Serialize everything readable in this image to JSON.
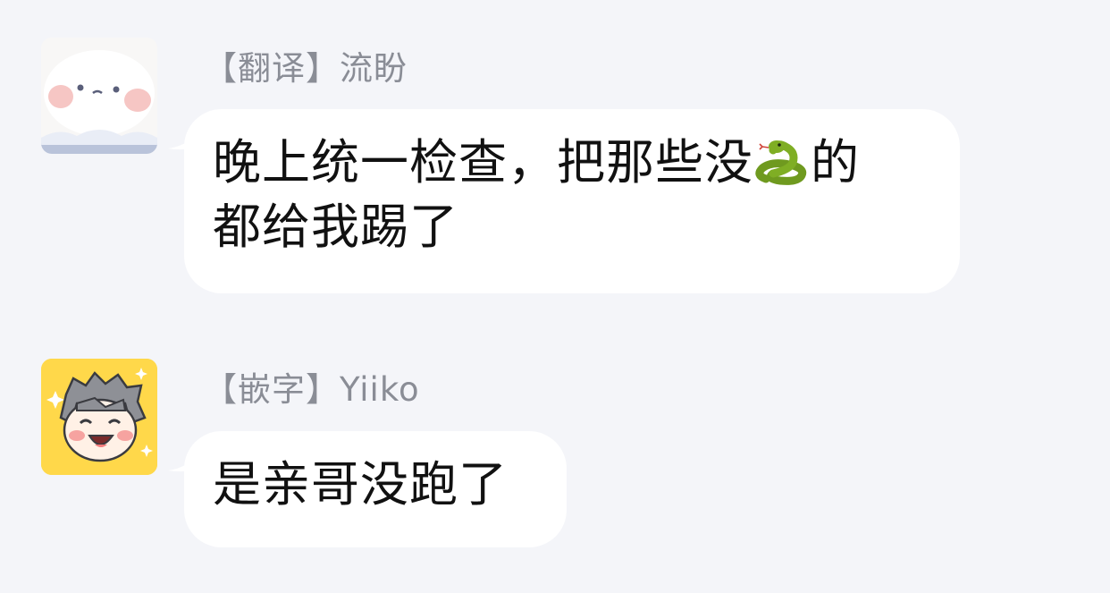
{
  "messages": [
    {
      "sender": "【翻译】流盼",
      "avatar_icon": "white-fluffy-cat-avatar",
      "text_line1": "晚上统一检查，把那些没",
      "emoji_icon": "snake-emoji",
      "text_line1_end": "的",
      "text_line2": "都给我踢了"
    },
    {
      "sender": "【嵌字】Yiiko",
      "avatar_icon": "cartoon-boy-avatar",
      "text": "是亲哥没跑了"
    }
  ],
  "colors": {
    "background": "#f4f5f9",
    "bubble": "#ffffff",
    "sender_text": "#8a8d96",
    "message_text": "#111111",
    "avatar2_bg": "#ffd84a"
  }
}
